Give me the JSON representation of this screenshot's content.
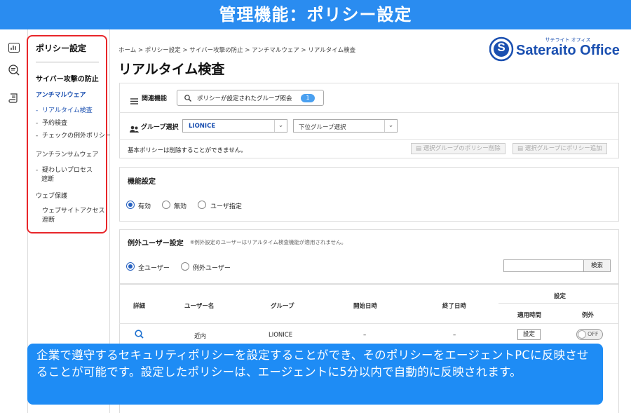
{
  "banner": {
    "title": "管理機能：ポリシー設定"
  },
  "rail": {
    "icons": [
      "chart-icon",
      "search-list-icon",
      "scroll-icon"
    ]
  },
  "sidebar": {
    "title": "ポリシー設定",
    "section1": "サイバー攻撃の防止",
    "group1": "アンチマルウェア",
    "item_realtime": "リアルタイム検査",
    "item_scheduled": "予約検査",
    "item_exception": "チェックの例外ポリシー",
    "group2": "アンチランサムウェア",
    "item_suspicious_1": "疑わしいプロセス",
    "item_suspicious_2": "遮断",
    "group3": "ウェブ保護",
    "item_web_1": "ウェブサイトアクセス",
    "item_web_2": "遮断",
    "bullet": "-"
  },
  "header": {
    "breadcrumb": "ホーム > ポリシー設定 > サイバー攻撃の防止 > アンチマルウェア > リアルタイム検査",
    "title": "リアルタイム検査",
    "logo_text": "Sateraito Office",
    "logo_sub": "サテライト オフィス",
    "logo_letter": "S"
  },
  "related": {
    "label": "関連機能",
    "button_label": "ポリシーが設定されたグループ照会",
    "badge": "1"
  },
  "group_select": {
    "label": "グループ選択",
    "value": "LIONICE",
    "sub_placeholder": "下位グループ選択",
    "note": "基本ポリシーは削除することができません。",
    "delete_button": "選択グループのポリシー削除",
    "add_button": "選択グループにポリシー追加"
  },
  "feature": {
    "title": "機能設定",
    "options": [
      "有効",
      "無効",
      "ユーザ指定"
    ],
    "selected": "有効"
  },
  "exception": {
    "title": "例外ユーザー設定",
    "note": "※例外設定のユーザーはリアルタイム検査機能が適用されません。",
    "options": [
      "全ユーザー",
      "例外ユーザー"
    ],
    "selected": "全ユーザー",
    "search_button": "検索",
    "search_value": ""
  },
  "table": {
    "headers": {
      "detail": "詳細",
      "user": "ユーザー名",
      "group": "グループ",
      "start": "開始日時",
      "end": "終了日時",
      "settings": "設定",
      "apply_time": "適用時間",
      "exception": "例外"
    },
    "rows": [
      {
        "user": "近内",
        "group": "LIONICE",
        "start": "–",
        "end": "–",
        "apply_button": "設定",
        "toggle": "OFF"
      }
    ]
  },
  "caption": {
    "text": "企業で遵守するセキュリティポリシーを設定することができ、そのポリシーをエージェントPCに反映させることが可能です。設定したポリシーは、エージェントに5分以内で自動的に反映されます。"
  },
  "colors": {
    "banner": "#2a8cf0",
    "caption": "#1e8cf5",
    "highlight_border": "#e8262a",
    "link_blue": "#1a4fb0",
    "badge": "#4aa0f0"
  }
}
